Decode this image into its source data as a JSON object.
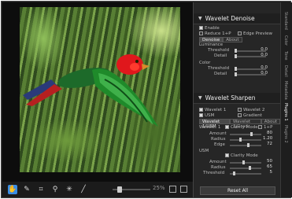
{
  "toolbar": {
    "zoom_label": "25%",
    "tools": [
      "hand-icon",
      "eyedropper-icon",
      "crop-icon",
      "adjust-icon",
      "retouch-icon",
      "brush-icon"
    ]
  },
  "denoise": {
    "title": "Wavelet Denoise",
    "enable_label": "Enable",
    "reduce_label": "Reduce 1+P",
    "edge_preview_label": "Edge Preview",
    "tabs": [
      "Denoise",
      "About"
    ],
    "luminance_label": "Luminance",
    "threshold_label": "Threshold",
    "threshold_value": "0.0",
    "detail_label": "Detail",
    "detail_value": "0.0",
    "color_label": "Color",
    "color_threshold_label": "Threshold",
    "color_threshold_value": "0.0",
    "color_detail_label": "Detail",
    "color_detail_value": "0.0"
  },
  "sharpen": {
    "title": "Wavelet Sharpen",
    "wavelet1_label": "Wavelet 1",
    "wavelet2_label": "Wavelet 2",
    "usm_label": "USM",
    "gradient_label": "Gradient",
    "tabs": [
      "Wavelet 1/USM",
      "Wavelet 2/Grad",
      "About"
    ],
    "w1_header": "Wavelet 1",
    "clarity_label": "Clarity Mode",
    "lp_label": "1+P",
    "amount_label": "Amount",
    "amount_value": "80",
    "radius_label": "Radius",
    "radius_value": "1.20",
    "edge_label": "Edge",
    "edge_value": "72",
    "usm_header": "USM",
    "usm_clarity_label": "Clarity Mode",
    "usm_amount_label": "Amount",
    "usm_amount_value": "50",
    "usm_radius_label": "Radius",
    "usm_radius_value": "65",
    "usm_threshold_label": "Threshold",
    "usm_threshold_value": "5"
  },
  "reset_label": "Reset All",
  "side_tabs": [
    "Standard",
    "Color",
    "Tone",
    "Detail",
    "Metadata",
    "Plugins 1",
    "Plugins 2"
  ]
}
